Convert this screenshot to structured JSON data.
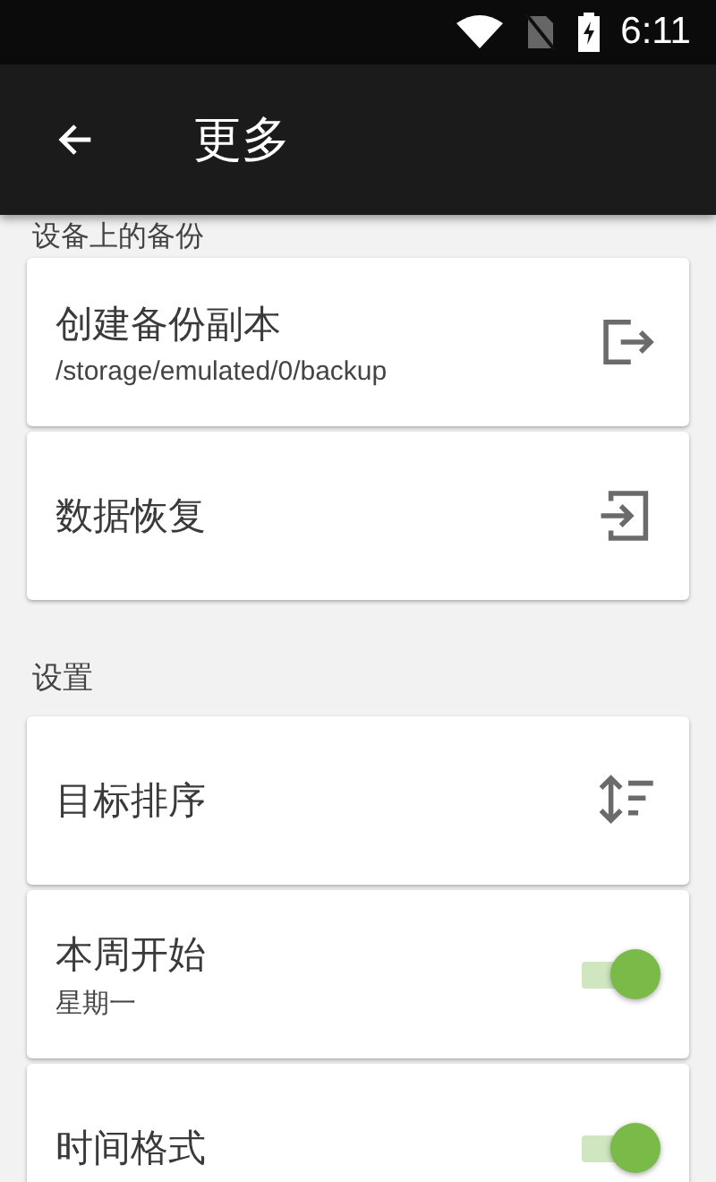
{
  "status_bar": {
    "time": "6:11"
  },
  "app_bar": {
    "title": "更多"
  },
  "sections": [
    {
      "title": "设备上的备份",
      "items": [
        {
          "kind": "export",
          "title": "创建备份副本",
          "subtitle": "/storage/emulated/0/backup"
        },
        {
          "kind": "import",
          "title": "数据恢复"
        }
      ]
    },
    {
      "title": "设置",
      "items": [
        {
          "kind": "sort",
          "title": "目标排序"
        },
        {
          "kind": "switch",
          "title": "本周开始",
          "subtitle": "星期一",
          "on": true
        },
        {
          "kind": "switch",
          "title": "时间格式",
          "on": true
        }
      ]
    }
  ]
}
